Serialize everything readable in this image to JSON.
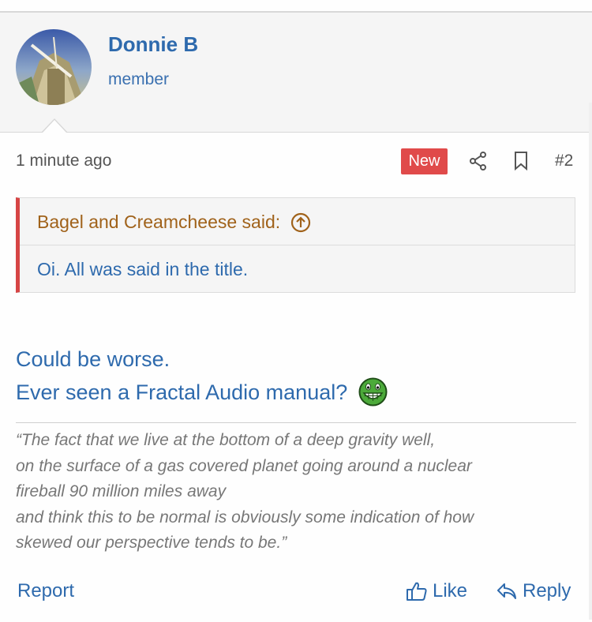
{
  "user": {
    "name": "Donnie B",
    "title": "member"
  },
  "post": {
    "time": "1 minute ago",
    "badge": "New",
    "number": "#2"
  },
  "quote": {
    "author_line": "Bagel and Creamcheese said:",
    "text": "Oi. All was said in the title."
  },
  "message": {
    "line1": "Could be worse.",
    "line2": "Ever seen a Fractal Audio manual?"
  },
  "signature": [
    "“The fact that we live at the bottom of a deep gravity well,",
    "on the surface of a gas covered planet going around a nuclear",
    "fireball 90 million miles away",
    "and think this to be normal is obviously some indication of how",
    "skewed our perspective tends to be.”"
  ],
  "actions": {
    "report": "Report",
    "like": "Like",
    "reply": "Reply"
  },
  "icons": {
    "share": "share-icon",
    "bookmark": "bookmark-icon",
    "quote_jump": "arrow-up-circle-icon",
    "like": "thumbs-up-icon",
    "reply": "reply-arrow-icon",
    "smiley": "grin-smiley-icon"
  },
  "colors": {
    "link": "#2e6aad",
    "badge_new": "#e04a4a",
    "quote_border": "#d64545",
    "quote_author": "#a0621a"
  }
}
